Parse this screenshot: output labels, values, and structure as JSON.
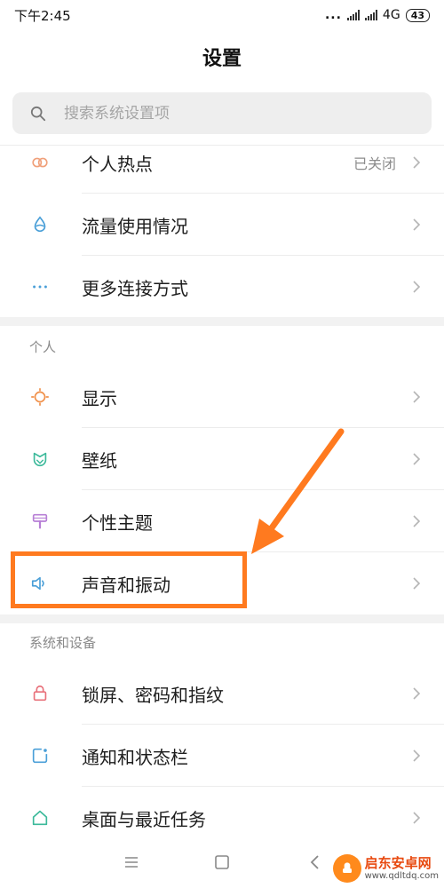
{
  "status_bar": {
    "time": "下午2:45",
    "dots": "...",
    "network": "4G",
    "battery": "43"
  },
  "header": {
    "title": "设置"
  },
  "search": {
    "placeholder": "搜索系统设置项",
    "icon": "search-icon"
  },
  "network_items": [
    {
      "label": "个人热点",
      "value": "已关闭",
      "icon": "hotspot-icon",
      "icon_color": "#f0a07a"
    },
    {
      "label": "流量使用情况",
      "value": "",
      "icon": "data-usage-icon",
      "icon_color": "#4a9fd8"
    },
    {
      "label": "更多连接方式",
      "value": "",
      "icon": "more-icon",
      "icon_color": "#4a9fd8"
    }
  ],
  "personal": {
    "header": "个人",
    "items": [
      {
        "label": "显示",
        "icon": "display-icon",
        "icon_color": "#f0904a"
      },
      {
        "label": "壁纸",
        "icon": "wallpaper-icon",
        "icon_color": "#3bb99a"
      },
      {
        "label": "个性主题",
        "icon": "theme-icon",
        "icon_color": "#b77fd6"
      },
      {
        "label": "声音和振动",
        "icon": "sound-icon",
        "icon_color": "#4a9fd8"
      }
    ]
  },
  "system": {
    "header": "系统和设备",
    "items": [
      {
        "label": "锁屏、密码和指纹",
        "icon": "lock-icon",
        "icon_color": "#e8707a"
      },
      {
        "label": "通知和状态栏",
        "icon": "notification-icon",
        "icon_color": "#4a9fd8"
      },
      {
        "label": "桌面与最近任务",
        "icon": "home-icon",
        "icon_color": "#3bb99a"
      }
    ]
  },
  "highlight_color": "#ff7a1f",
  "watermark": {
    "title": "启东安卓网",
    "url": "www.qdltdq.com"
  }
}
